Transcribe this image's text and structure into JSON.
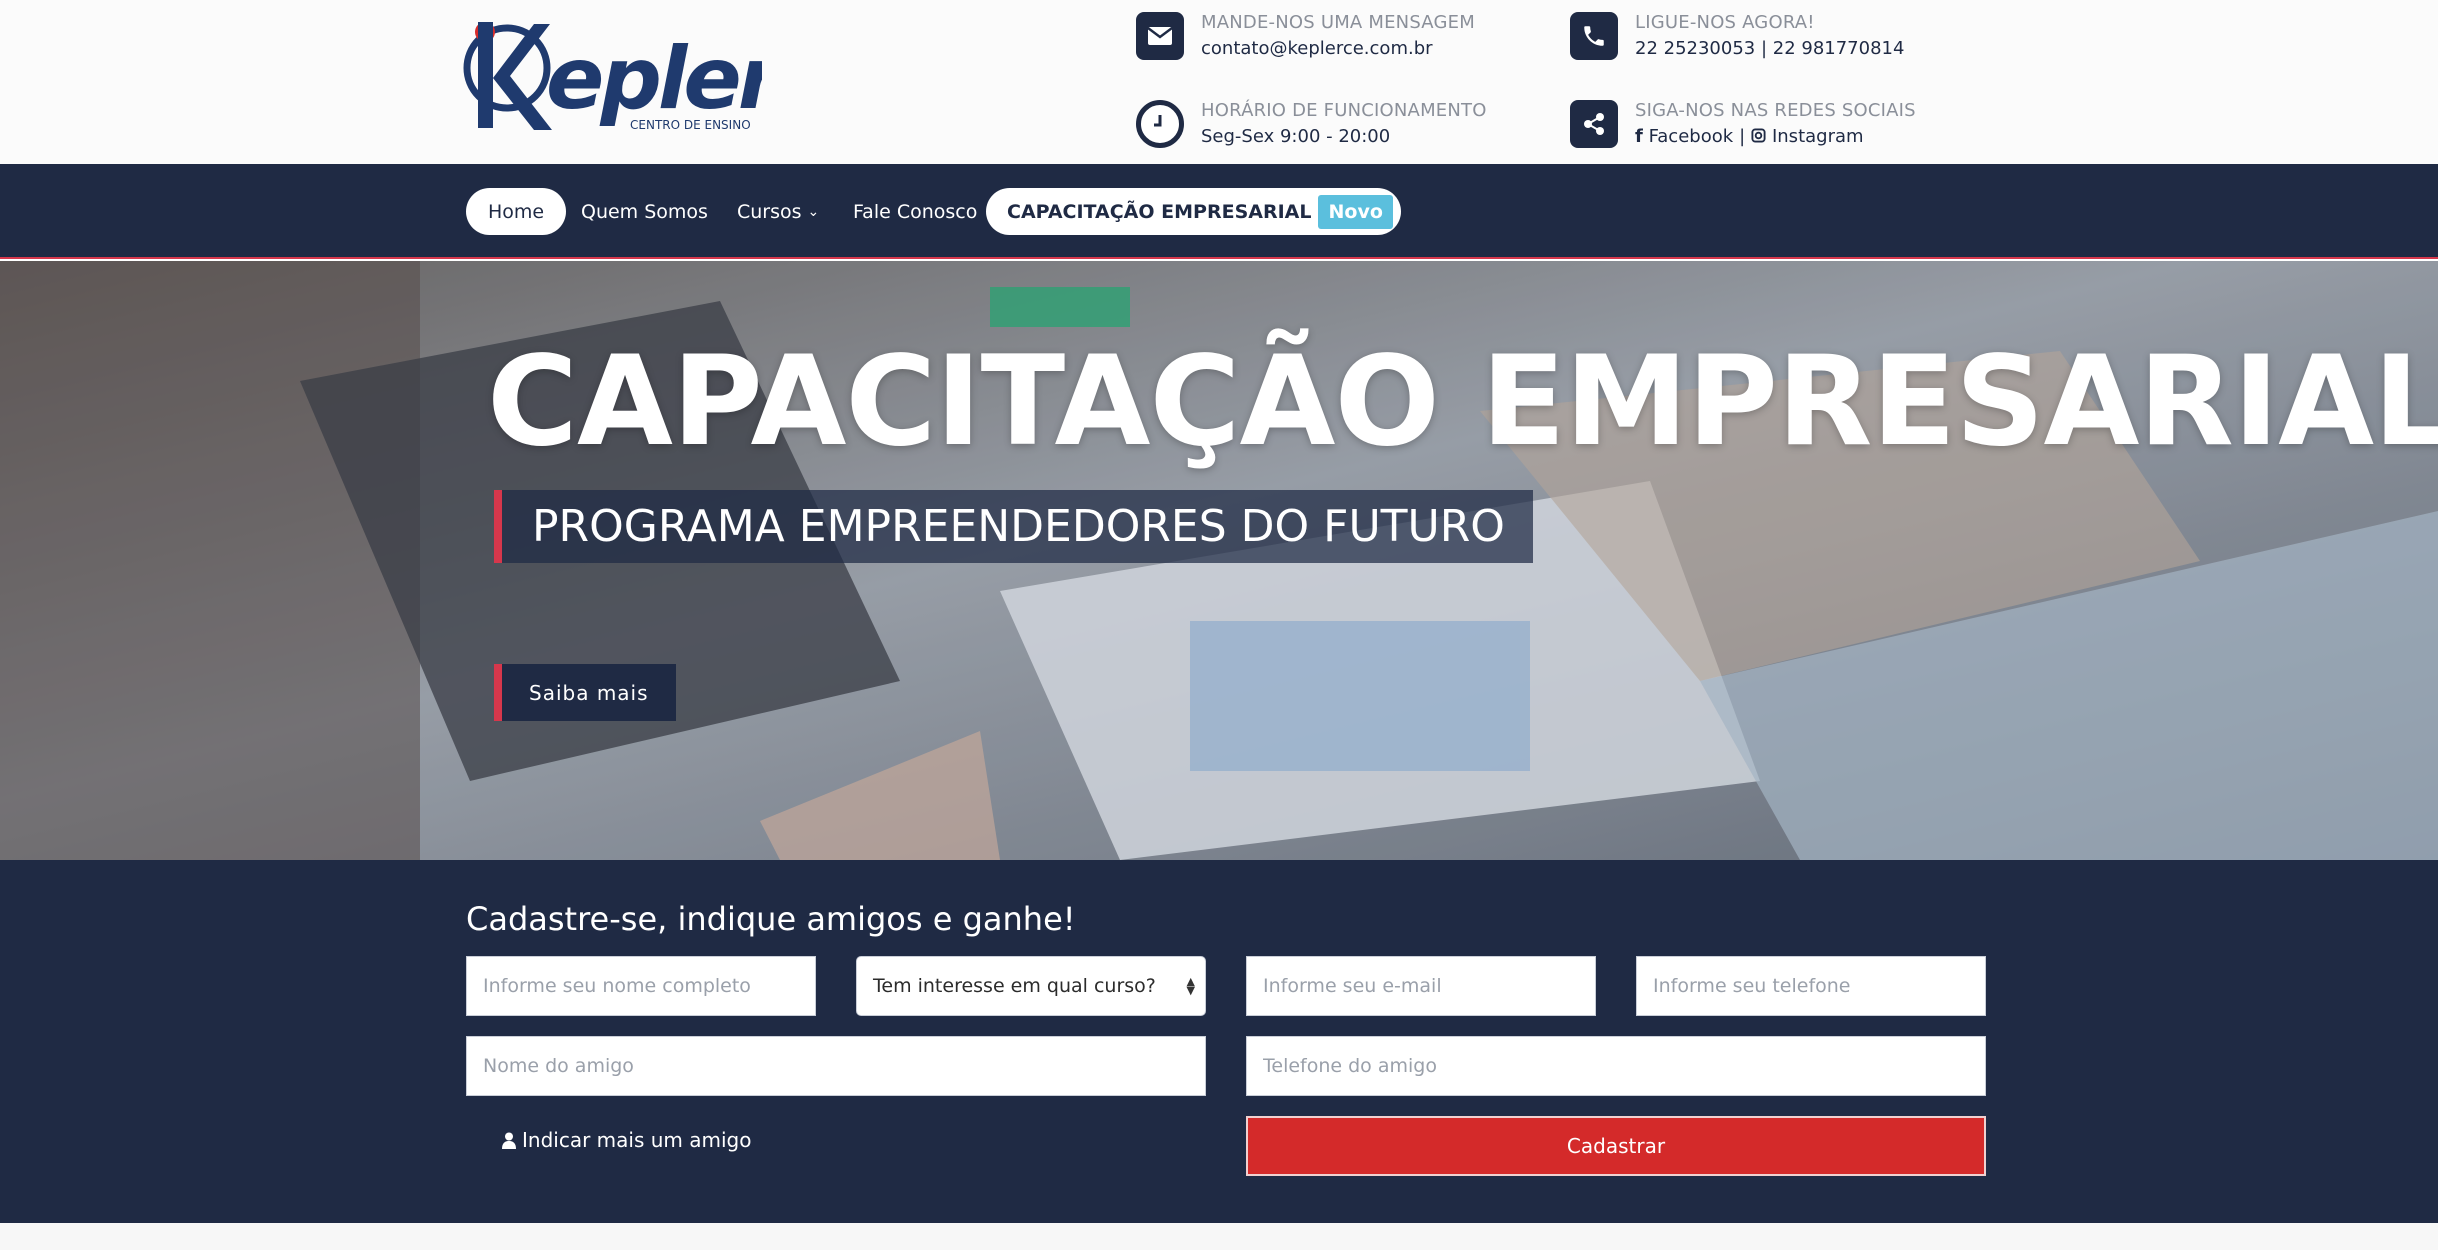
{
  "logo": {
    "name": "Kepler",
    "tagline": "CENTRO DE ENSINO"
  },
  "contacts": {
    "message": {
      "label": "MANDE-NOS UMA MENSAGEM",
      "value": "contato@keplerce.com.br",
      "icon": "envelope-icon"
    },
    "phone": {
      "label": "LIGUE-NOS AGORA!",
      "value": "22 25230053 | 22 981770814",
      "icon": "phone-icon"
    },
    "hours": {
      "label": "HORÁRIO DE FUNCIONAMENTO",
      "value": "Seg-Sex 9:00 - 20:00",
      "icon": "clock-icon"
    },
    "social": {
      "label": "SIGA-NOS NAS REDES SOCIAIS",
      "facebook": "Facebook",
      "separator": "|",
      "instagram": "Instagram",
      "icon": "share-icon"
    }
  },
  "nav": {
    "home": "Home",
    "about": "Quem Somos",
    "courses": "Cursos",
    "contact": "Fale Conosco",
    "business": "CAPACITAÇÃO EMPRESARIAL",
    "business_badge": "Novo"
  },
  "hero": {
    "title": "CAPACITAÇÃO EMPRESARIAL",
    "subtitle": "PROGRAMA EMPREENDEDORES DO FUTURO",
    "button": "Saiba mais"
  },
  "form": {
    "title": "Cadastre-se, indique amigos e ganhe!",
    "name_placeholder": "Informe seu nome completo",
    "course_select": "Tem interesse em qual curso?",
    "email_placeholder": "Informe seu e-mail",
    "phone_placeholder": "Informe seu telefone",
    "friend_name_placeholder": "Nome do amigo",
    "friend_phone_placeholder": "Telefone do amigo",
    "add_friend": "Indicar mais um amigo",
    "submit": "Cadastrar"
  },
  "colors": {
    "navy": "#1f2a44",
    "accent_red": "#d6374c",
    "submit_red": "#d42a2a",
    "badge_blue": "#5bbfdd"
  }
}
